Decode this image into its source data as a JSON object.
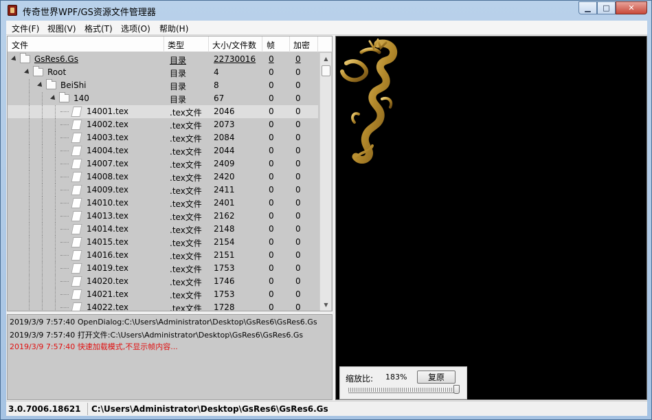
{
  "window": {
    "title": "传奇世界WPF/GS资源文件管理器",
    "minimize_glyph": "▁",
    "maximize_glyph": "□",
    "close_glyph": "✕"
  },
  "menu": [
    "文件(F)",
    "视图(V)",
    "格式(T)",
    "选项(O)",
    "帮助(H)"
  ],
  "columns": [
    "文件",
    "类型",
    "大小/文件数",
    "帧",
    "加密"
  ],
  "tree": [
    {
      "name": "GsRes6.Gs",
      "type": "目录",
      "size": "22730016",
      "frames": "0",
      "encrypted": "0",
      "level": 0,
      "kind": "root",
      "underline": true
    },
    {
      "name": "Root",
      "type": "目录",
      "size": "4",
      "frames": "0",
      "encrypted": "0",
      "level": 1,
      "kind": "folder"
    },
    {
      "name": "BeiShi",
      "type": "目录",
      "size": "8",
      "frames": "0",
      "encrypted": "0",
      "level": 2,
      "kind": "folder"
    },
    {
      "name": "140",
      "type": "目录",
      "size": "67",
      "frames": "0",
      "encrypted": "0",
      "level": 3,
      "kind": "folder"
    },
    {
      "name": "14001.tex",
      "type": ".tex文件",
      "size": "2046",
      "frames": "0",
      "encrypted": "0",
      "level": 4,
      "kind": "file",
      "selected": true
    },
    {
      "name": "14002.tex",
      "type": ".tex文件",
      "size": "2073",
      "frames": "0",
      "encrypted": "0",
      "level": 4,
      "kind": "file"
    },
    {
      "name": "14003.tex",
      "type": ".tex文件",
      "size": "2084",
      "frames": "0",
      "encrypted": "0",
      "level": 4,
      "kind": "file"
    },
    {
      "name": "14004.tex",
      "type": ".tex文件",
      "size": "2044",
      "frames": "0",
      "encrypted": "0",
      "level": 4,
      "kind": "file"
    },
    {
      "name": "14007.tex",
      "type": ".tex文件",
      "size": "2409",
      "frames": "0",
      "encrypted": "0",
      "level": 4,
      "kind": "file"
    },
    {
      "name": "14008.tex",
      "type": ".tex文件",
      "size": "2420",
      "frames": "0",
      "encrypted": "0",
      "level": 4,
      "kind": "file"
    },
    {
      "name": "14009.tex",
      "type": ".tex文件",
      "size": "2411",
      "frames": "0",
      "encrypted": "0",
      "level": 4,
      "kind": "file"
    },
    {
      "name": "14010.tex",
      "type": ".tex文件",
      "size": "2401",
      "frames": "0",
      "encrypted": "0",
      "level": 4,
      "kind": "file"
    },
    {
      "name": "14013.tex",
      "type": ".tex文件",
      "size": "2162",
      "frames": "0",
      "encrypted": "0",
      "level": 4,
      "kind": "file"
    },
    {
      "name": "14014.tex",
      "type": ".tex文件",
      "size": "2148",
      "frames": "0",
      "encrypted": "0",
      "level": 4,
      "kind": "file"
    },
    {
      "name": "14015.tex",
      "type": ".tex文件",
      "size": "2154",
      "frames": "0",
      "encrypted": "0",
      "level": 4,
      "kind": "file"
    },
    {
      "name": "14016.tex",
      "type": ".tex文件",
      "size": "2151",
      "frames": "0",
      "encrypted": "0",
      "level": 4,
      "kind": "file"
    },
    {
      "name": "14019.tex",
      "type": ".tex文件",
      "size": "1753",
      "frames": "0",
      "encrypted": "0",
      "level": 4,
      "kind": "file"
    },
    {
      "name": "14020.tex",
      "type": ".tex文件",
      "size": "1746",
      "frames": "0",
      "encrypted": "0",
      "level": 4,
      "kind": "file"
    },
    {
      "name": "14021.tex",
      "type": ".tex文件",
      "size": "1753",
      "frames": "0",
      "encrypted": "0",
      "level": 4,
      "kind": "file"
    },
    {
      "name": "14022.tex",
      "type": ".tex文件",
      "size": "1728",
      "frames": "0",
      "encrypted": "0",
      "level": 4,
      "kind": "file"
    }
  ],
  "log": [
    {
      "time": "2019/3/9 7:57:40",
      "text": "OpenDialog:C:\\Users\\Administrator\\Desktop\\GsRes6\\GsRes6.Gs",
      "error": false
    },
    {
      "time": "2019/3/9 7:57:40",
      "text": "打开文件:C:\\Users\\Administrator\\Desktop\\GsRes6\\GsRes6.Gs",
      "error": false
    },
    {
      "time": "2019/3/9 7:57:40",
      "text": "快速加载模式,不显示帧内容...",
      "error": true
    }
  ],
  "zoom": {
    "label": "缩放比:",
    "value": "183%",
    "reset_label": "复原",
    "slider_fraction": 0.98
  },
  "status": {
    "version": "3.0.7006.18621",
    "path": "C:\\Users\\Administrator\\Desktop\\GsRes6\\GsRes6.Gs"
  },
  "colors": {
    "log_error": "#e01010",
    "preview_bg": "#000000",
    "dragon_gold": "#c9a03a"
  }
}
